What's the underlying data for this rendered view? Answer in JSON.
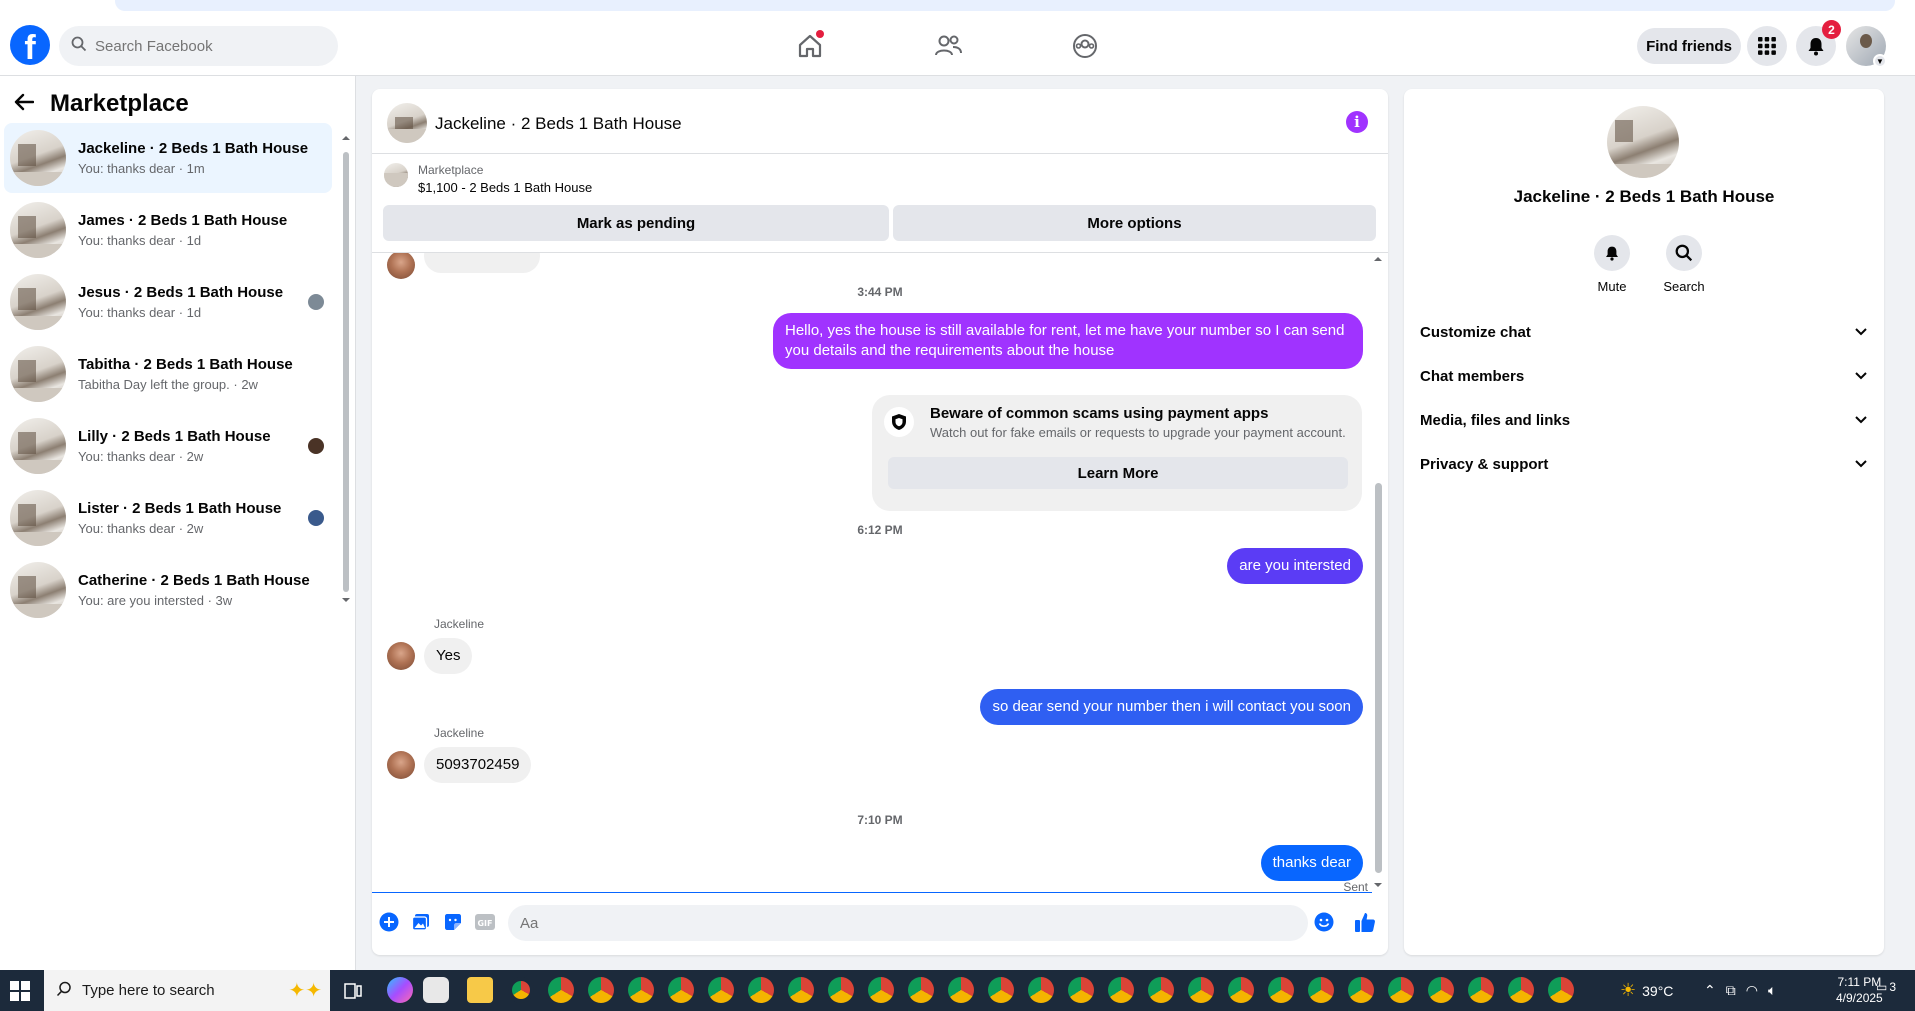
{
  "topnav": {
    "search_placeholder": "Search Facebook",
    "find_friends": "Find friends",
    "notification_count": "2"
  },
  "sidebar": {
    "title": "Marketplace",
    "conversations": [
      {
        "title": "Jackeline · 2 Beds 1 Bath House",
        "subtitle": "You: thanks dear · 1m"
      },
      {
        "title": "James · 2 Beds 1 Bath House",
        "subtitle": "You: thanks dear · 1d"
      },
      {
        "title": "Jesus · 2 Beds 1 Bath House",
        "subtitle": "You: thanks dear · 1d"
      },
      {
        "title": "Tabitha · 2 Beds 1 Bath House",
        "subtitle": "Tabitha Day left the group. · 2w"
      },
      {
        "title": "Lilly · 2 Beds 1 Bath House",
        "subtitle": "You: thanks dear · 2w"
      },
      {
        "title": "Lister · 2 Beds 1 Bath House",
        "subtitle": "You: thanks dear · 2w"
      },
      {
        "title": "Catherine · 2 Beds 1 Bath House",
        "subtitle": "You: are you intersted · 3w"
      }
    ]
  },
  "chat": {
    "title": "Jackeline · 2 Beds 1 Bath House",
    "listing_label": "Marketplace",
    "listing_price": "$1,100 - 2 Beds 1 Bath House",
    "mark_pending": "Mark as pending",
    "more_options": "More options",
    "messages": {
      "time1": "3:44 PM",
      "out1": "Hello, yes the house is still available for rent, let me have your number so I can send you details and the requirements about the house",
      "scam_title": "Beware of common scams using payment apps",
      "scam_desc": "Watch out for fake emails or requests to upgrade your payment account.",
      "learn_more": "Learn More",
      "time2": "6:12 PM",
      "out2": "are you intersted",
      "sender1": "Jackeline",
      "in1": "Yes",
      "out3": "so dear send your number then i will contact you soon",
      "sender2": "Jackeline",
      "in2": "5093702459",
      "time3": "7:10 PM",
      "out4": "thanks dear",
      "status": "Sent"
    },
    "input_placeholder": "Aa"
  },
  "details": {
    "title": "Jackeline · 2 Beds 1 Bath House",
    "mute": "Mute",
    "search": "Search",
    "sections": [
      "Customize chat",
      "Chat members",
      "Media, files and links",
      "Privacy & support"
    ]
  },
  "taskbar": {
    "search_placeholder": "Type here to search",
    "weather": "39°C",
    "time": "7:11 PM",
    "date": "4/9/2025",
    "notifications": "3"
  },
  "colors": {
    "brand": "#0866ff",
    "bubble_purple": "#a033ff",
    "bubble_indigo": "#5b3cf5",
    "bubble_blue": "#2f5ff2"
  }
}
